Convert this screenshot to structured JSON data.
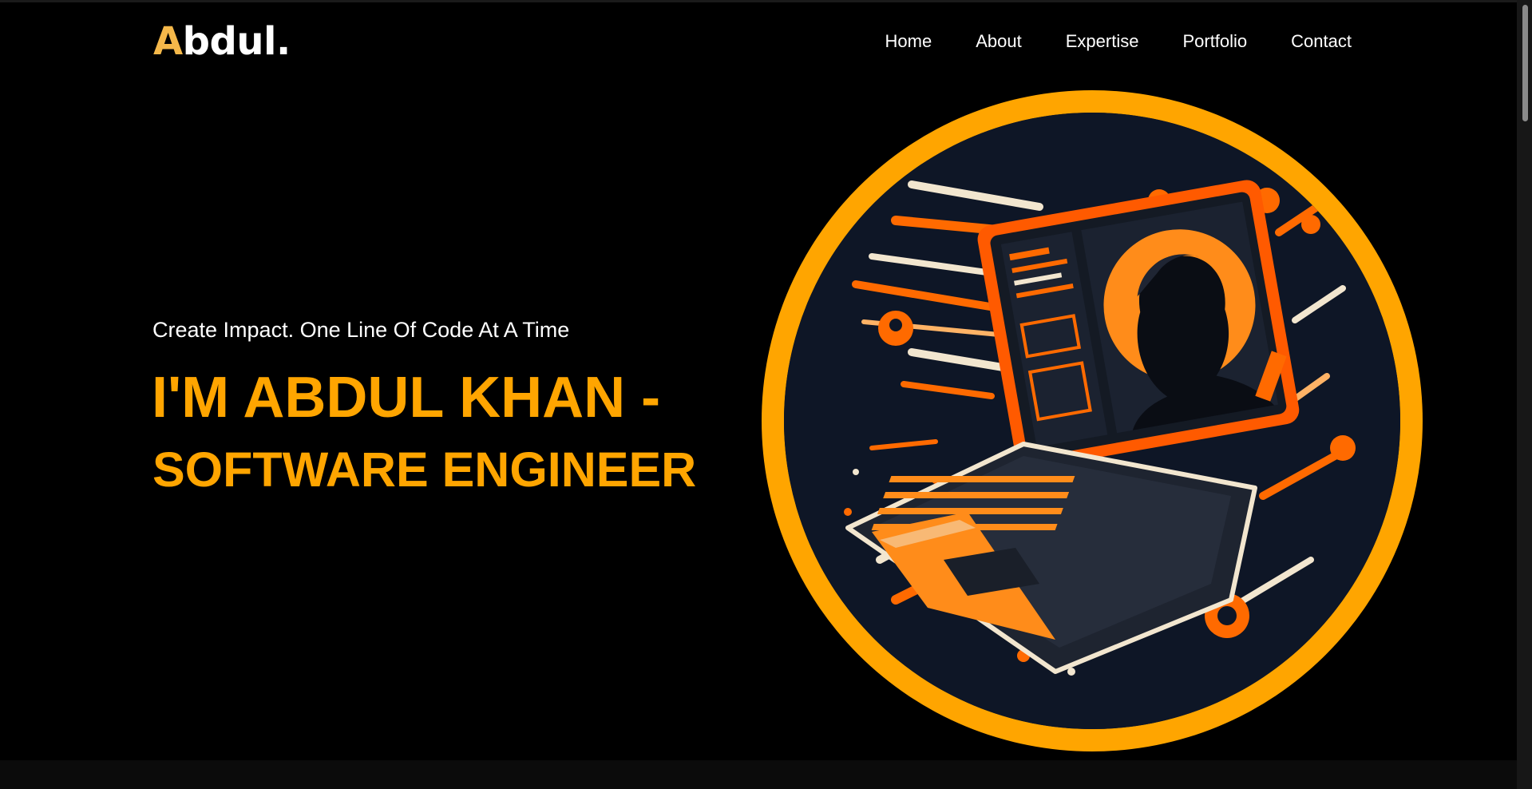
{
  "header": {
    "logo_initial": "A",
    "logo_rest": "bdul."
  },
  "nav": {
    "items": [
      "Home",
      "About",
      "Expertise",
      "Portfolio",
      "Contact"
    ]
  },
  "hero": {
    "tagline": "Create Impact. One Line Of Code At A Time",
    "title_line1": "I'M ABDUL KHAN -",
    "title_line2": "SOFTWARE ENGINEER",
    "image_label": "laptop-with-developer-illustration"
  },
  "colors": {
    "accent": "#ffa500",
    "logo_accent": "#f5b84a",
    "background": "#000000",
    "text": "#ffffff",
    "illustration_bg": "#0e1626",
    "illustration_orange": "#ff6a00"
  }
}
